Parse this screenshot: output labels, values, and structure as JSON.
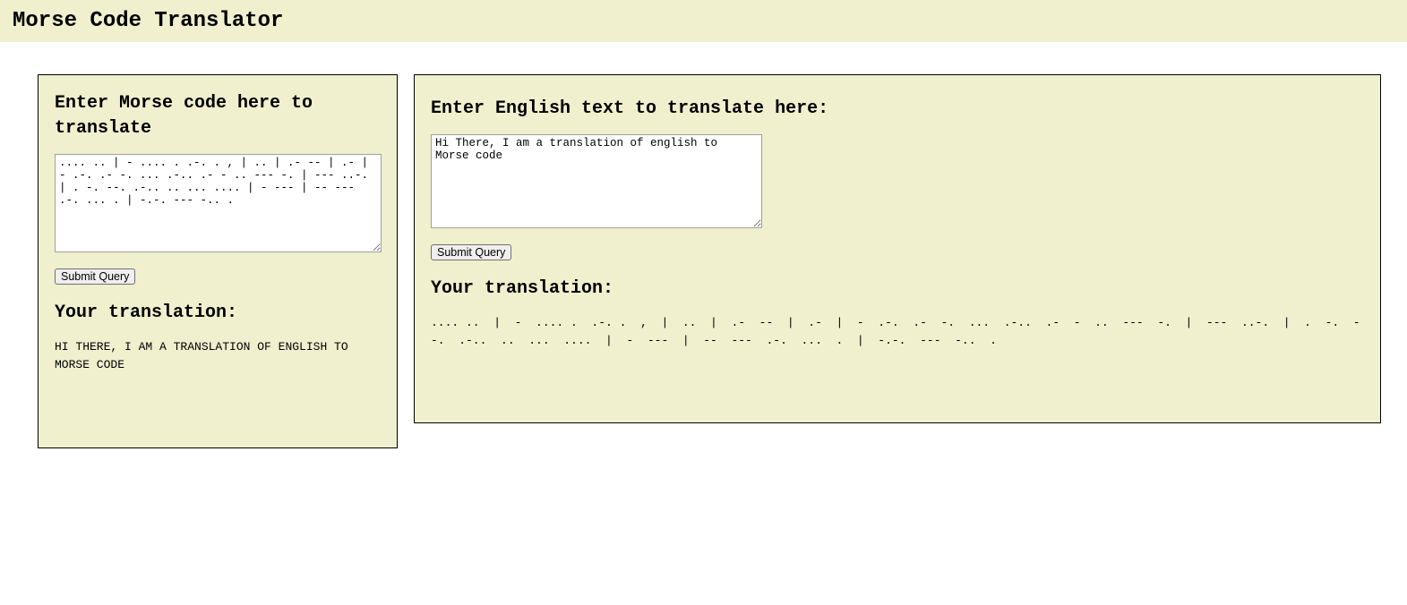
{
  "header": {
    "title": "Morse Code Translator"
  },
  "leftPanel": {
    "heading": "Enter Morse code here to translate",
    "textarea_value": ".... .. | - .... . .-. . , | .. | .- -- | .- | - .-. .- -. ... .-.. .- - .. --- -. | --- ..-. | . -. --. .-.. .. ... .... | - --- | -- --- .-. ... . | -.-. --- -.. .",
    "submit_label": "Submit Query",
    "translation_heading": "Your translation:",
    "translation_output": "HI THERE, I AM A TRANSLATION OF ENGLISH TO MORSE CODE"
  },
  "rightPanel": {
    "heading": "Enter English text to translate here:",
    "textarea_value_pre": "Hi There, I am a translation of ",
    "textarea_value_spell": "english",
    "textarea_value_post": " to Morse code",
    "textarea_full": "Hi There, I am a translation of english to Morse code",
    "submit_label": "Submit Query",
    "translation_heading": "Your translation:",
    "translation_output": ".... ..  |  -  .... .  .-. .  ,  |  ..  |  .-  --  |  .-  |  -  .-.  .-  -.  ...  .-..  .-  -  ..  ---  -.  |  ---  ..-.  |  .  -.  --.  .-..  ..  ...  ....  |  -  ---  |  --  ---  .-.  ...  .  |  -.-.  ---  -..  ."
  }
}
